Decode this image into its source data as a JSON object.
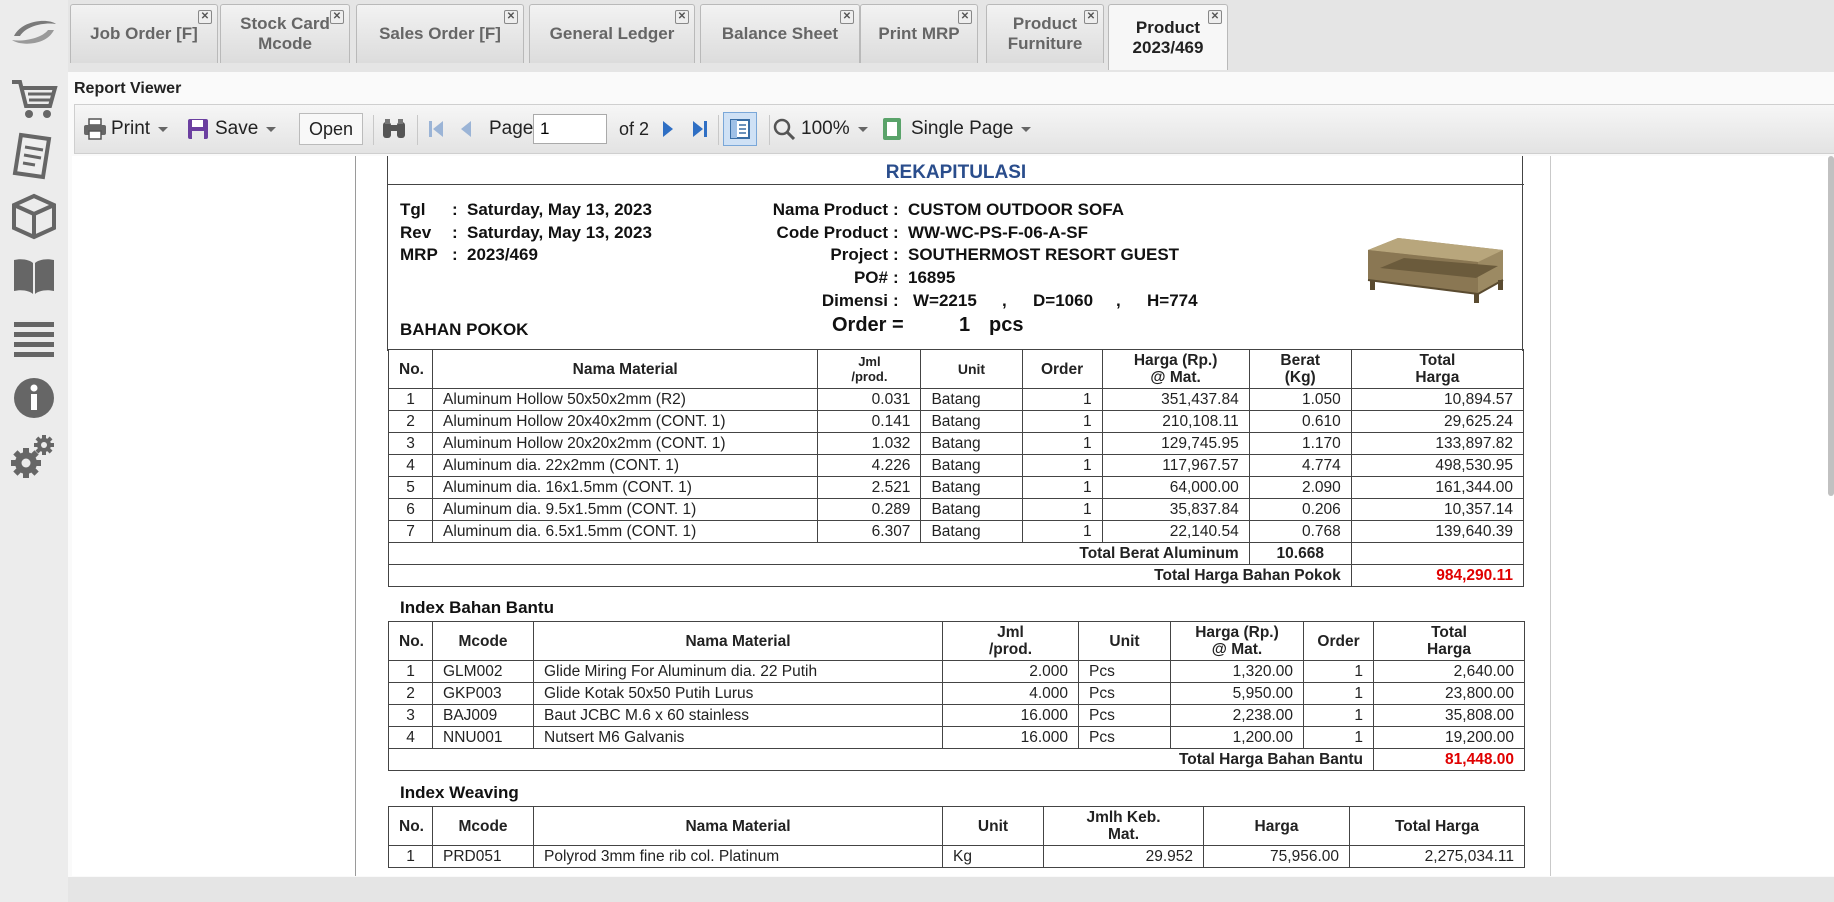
{
  "tabs": [
    {
      "label": "Job Order [F]"
    },
    {
      "label": "Stock Card\nMcode"
    },
    {
      "label": "Sales Order [F]"
    },
    {
      "label": "General Ledger"
    },
    {
      "label": "Balance Sheet"
    },
    {
      "label": "Print MRP"
    },
    {
      "label": "Product\nFurniture"
    },
    {
      "label": "Product\n2023/469",
      "active": true
    }
  ],
  "sidebar": [
    "cart-icon",
    "document-icon",
    "box-icon",
    "book-icon",
    "list-icon",
    "info-icon",
    "settings-icon"
  ],
  "panel": {
    "title": "Report Viewer"
  },
  "toolbar": {
    "print": "Print",
    "save": "Save",
    "open": "Open",
    "page_label": "Page",
    "page_value": "1",
    "of_pages": "of 2",
    "zoom": "100%",
    "view_mode": "Single Page"
  },
  "report": {
    "title": "REKAPITULASI",
    "tgl_label": "Tgl",
    "tgl": "Saturday, May 13, 2023",
    "rev_label": "Rev",
    "rev": "Saturday, May 13, 2023",
    "mrp_label": "MRP",
    "mrp": "2023/469",
    "nama_product_label": "Nama Product",
    "nama_product": "CUSTOM OUTDOOR SOFA",
    "code_product_label": "Code Product",
    "code_product": "WW-WC-PS-F-06-A-SF",
    "project_label": "Project",
    "project": "SOUTHERMOST RESORT GUEST",
    "po_label": "PO#",
    "po": "16895",
    "dimensi_label": "Dimensi",
    "w": "W=2215",
    "d": "D=1060",
    "h": "H=774",
    "order_label": "Order =",
    "order_qty": "1",
    "order_unit": "pcs",
    "colon": ":",
    "comma": ","
  },
  "bahan_pokok": {
    "title": "BAHAN POKOK",
    "headers": [
      "No.",
      "Nama Material",
      "Jml\n/prod.",
      "Unit",
      "Order",
      "Harga (Rp.)\n@ Mat.",
      "Berat\n(Kg)",
      "Total\nHarga"
    ],
    "rows": [
      [
        "1",
        "Aluminum Hollow 50x50x2mm (R2)",
        "0.031",
        "Batang",
        "1",
        "351,437.84",
        "1.050",
        "10,894.57"
      ],
      [
        "2",
        "Aluminum Hollow 20x40x2mm (CONT. 1)",
        "0.141",
        "Batang",
        "1",
        "210,108.11",
        "0.610",
        "29,625.24"
      ],
      [
        "3",
        "Aluminum Hollow 20x20x2mm (CONT. 1)",
        "1.032",
        "Batang",
        "1",
        "129,745.95",
        "1.170",
        "133,897.82"
      ],
      [
        "4",
        "Aluminum dia. 22x2mm (CONT. 1)",
        "4.226",
        "Batang",
        "1",
        "117,967.57",
        "4.774",
        "498,530.95"
      ],
      [
        "5",
        "Aluminum dia. 16x1.5mm (CONT. 1)",
        "2.521",
        "Batang",
        "1",
        "64,000.00",
        "2.090",
        "161,344.00"
      ],
      [
        "6",
        "Aluminum dia. 9.5x1.5mm (CONT. 1)",
        "0.289",
        "Batang",
        "1",
        "35,837.84",
        "0.206",
        "10,357.14"
      ],
      [
        "7",
        "Aluminum dia. 6.5x1.5mm (CONT. 1)",
        "6.307",
        "Batang",
        "1",
        "22,140.54",
        "0.768",
        "139,640.39"
      ]
    ],
    "total_berat_label": "Total Berat Aluminum",
    "total_berat": "10.668",
    "total_harga_label": "Total Harga Bahan Pokok",
    "total_harga": "984,290.11"
  },
  "bahan_bantu": {
    "title": "Index Bahan Bantu",
    "headers": [
      "No.",
      "Mcode",
      "Nama Material",
      "Jml\n/prod.",
      "Unit",
      "Harga (Rp.)\n@ Mat.",
      "Order",
      "Total\nHarga"
    ],
    "rows": [
      [
        "1",
        "GLM002",
        "Glide Miring For Aluminum dia. 22 Putih",
        "2.000",
        "Pcs",
        "1,320.00",
        "1",
        "2,640.00"
      ],
      [
        "2",
        "GKP003",
        "Glide Kotak 50x50 Putih Lurus",
        "4.000",
        "Pcs",
        "5,950.00",
        "1",
        "23,800.00"
      ],
      [
        "3",
        "BAJ009",
        "Baut JCBC M.6 x 60 stainless",
        "16.000",
        "Pcs",
        "2,238.00",
        "1",
        "35,808.00"
      ],
      [
        "4",
        "NNU001",
        "Nutsert M6 Galvanis",
        "16.000",
        "Pcs",
        "1,200.00",
        "1",
        "19,200.00"
      ]
    ],
    "total_label": "Total Harga Bahan Bantu",
    "total": "81,448.00"
  },
  "weaving": {
    "title": "Index Weaving",
    "headers": [
      "No.",
      "Mcode",
      "Nama Material",
      "Unit",
      "Jmlh Keb.\nMat.",
      "Harga",
      "Total Harga"
    ],
    "rows": [
      [
        "1",
        "PRD051",
        "Polyrod 3mm fine rib col. Platinum",
        "Kg",
        "29.952",
        "75,956.00",
        "2,275,034.11"
      ]
    ]
  }
}
